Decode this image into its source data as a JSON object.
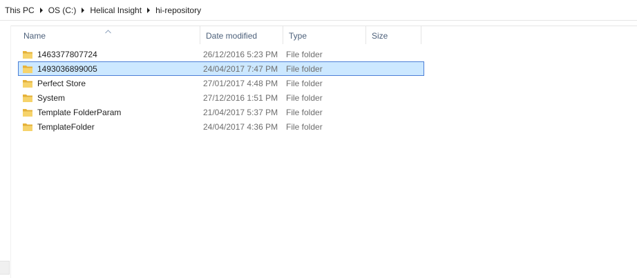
{
  "breadcrumb": {
    "items": [
      "This PC",
      "OS (C:)",
      "Helical Insight",
      "hi-repository"
    ]
  },
  "columns": {
    "name": "Name",
    "date_modified": "Date modified",
    "type": "Type",
    "size": "Size",
    "sorted_by": "Name"
  },
  "files": [
    {
      "name": "1463377807724",
      "date": "26/12/2016 5:23 PM",
      "type": "File folder",
      "selected": false
    },
    {
      "name": "1493036899005",
      "date": "24/04/2017 7:47 PM",
      "type": "File folder",
      "selected": true
    },
    {
      "name": "Perfect Store",
      "date": "27/01/2017 4:48 PM",
      "type": "File folder",
      "selected": false
    },
    {
      "name": "System",
      "date": "27/12/2016 1:51 PM",
      "type": "File folder",
      "selected": false
    },
    {
      "name": "Template FolderParam",
      "date": "21/04/2017 5:37 PM",
      "type": "File folder",
      "selected": false
    },
    {
      "name": "TemplateFolder",
      "date": "24/04/2017 4:36 PM",
      "type": "File folder",
      "selected": false
    }
  ],
  "icons": {
    "separator": "chevron-right-icon",
    "folder": "folder-icon",
    "sort": "sort-ascending-icon"
  },
  "colors": {
    "selection_fill": "#cce8ff",
    "selection_border": "#4a7ed6",
    "header_text": "#4c607a",
    "detail_text": "#6d6d6d",
    "folder_yellow": "#f3c63f"
  }
}
